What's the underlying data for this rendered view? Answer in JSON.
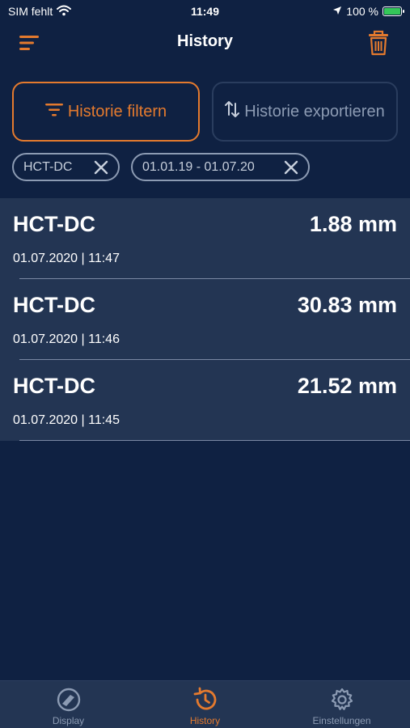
{
  "status_bar": {
    "carrier": "SIM fehlt",
    "time": "11:49",
    "battery": "100 %"
  },
  "nav": {
    "title": "History",
    "menu_icon": "hamburger-menu-icon",
    "trash_icon": "trash-icon"
  },
  "actions": {
    "filter_label": "Historie filtern",
    "export_label": "Historie exportieren"
  },
  "filters": [
    {
      "label": "HCT-DC"
    },
    {
      "label": "01.01.19 - 01.07.20"
    }
  ],
  "history": [
    {
      "name": "HCT-DC",
      "value": "1.88 mm",
      "date": "01.07.2020 | 11:47"
    },
    {
      "name": "HCT-DC",
      "value": "30.83 mm",
      "date": "01.07.2020 | 11:46"
    },
    {
      "name": "HCT-DC",
      "value": "21.52 mm",
      "date": "01.07.2020 | 11:45"
    }
  ],
  "tabs": [
    {
      "label": "Display",
      "icon": "caliper-gauge-icon",
      "active": false
    },
    {
      "label": "History",
      "icon": "history-clock-icon",
      "active": true
    },
    {
      "label": "Einstellungen",
      "icon": "gear-icon",
      "active": false
    }
  ],
  "colors": {
    "background": "#0f2142",
    "accent": "#e47a2e",
    "list_background": "#233553",
    "muted": "#8c9bb3",
    "battery": "#34c759"
  }
}
